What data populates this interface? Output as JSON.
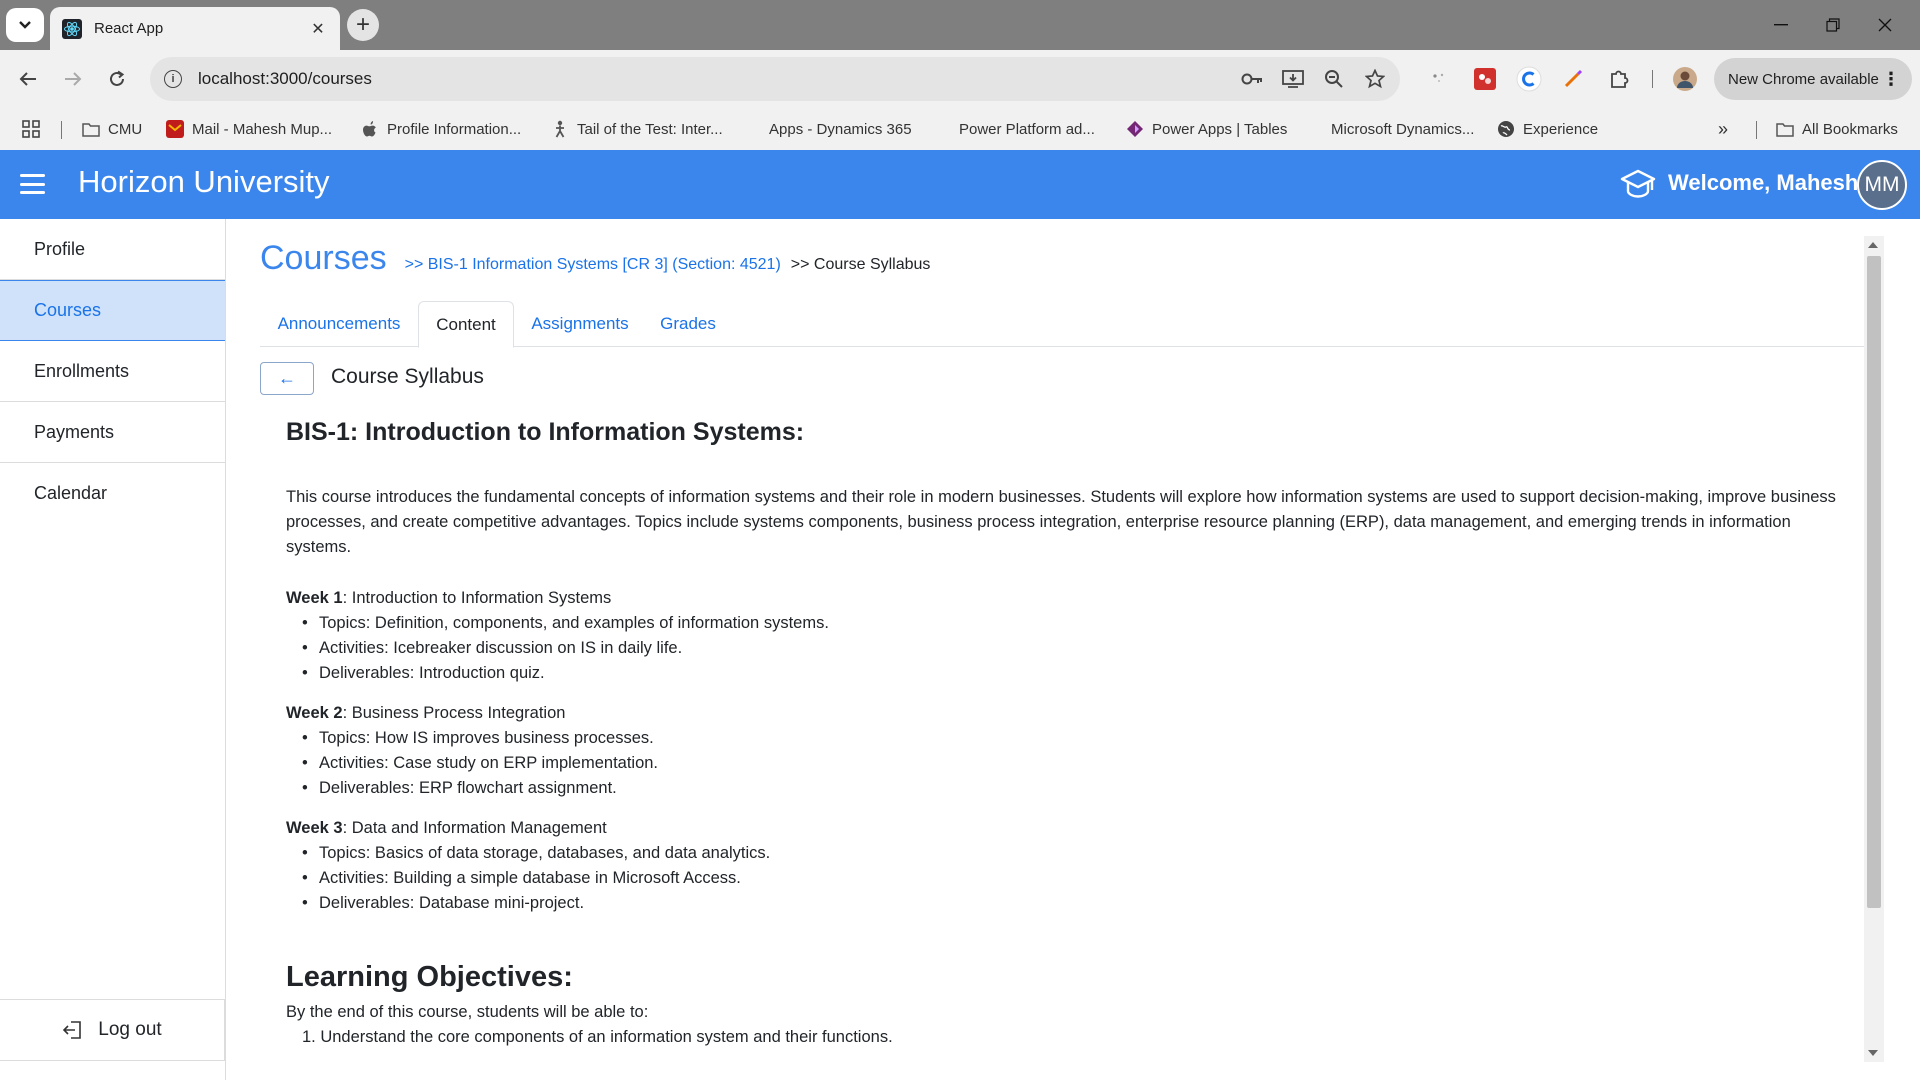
{
  "browser": {
    "tab_title": "React App",
    "url": "localhost:3000/courses",
    "update_label": "New Chrome available",
    "bookmarks": [
      {
        "label": "CMU",
        "icon": "folder-icon"
      },
      {
        "label": "Mail - Mahesh Mup...",
        "icon": "mail-icon"
      },
      {
        "label": "Profile Information...",
        "icon": "apple-icon"
      },
      {
        "label": "Tail of the Test: Inter...",
        "icon": "figure-icon"
      },
      {
        "label": "Apps - Dynamics 365",
        "icon": "microsoft-icon"
      },
      {
        "label": "Power Platform ad...",
        "icon": "microsoft-icon"
      },
      {
        "label": "Power Apps | Tables",
        "icon": "power-apps-icon"
      },
      {
        "label": "Microsoft Dynamics...",
        "icon": "microsoft-icon"
      },
      {
        "label": "Experience",
        "icon": "globe-icon"
      }
    ],
    "all_bookmarks_label": "All Bookmarks"
  },
  "header": {
    "brand": "Horizon University",
    "welcome": "Welcome, Mahesh",
    "avatar_initials": "MM",
    "colors": {
      "primary": "#3b86ed"
    }
  },
  "sidebar": {
    "items": [
      {
        "label": "Profile",
        "active": false
      },
      {
        "label": "Courses",
        "active": true
      },
      {
        "label": "Enrollments",
        "active": false
      },
      {
        "label": "Payments",
        "active": false
      },
      {
        "label": "Calendar",
        "active": false
      }
    ],
    "logout_label": "Log out"
  },
  "page": {
    "title": "Courses",
    "breadcrumb_link": ">> BIS-1 Information Systems [CR 3] (Section: 4521)",
    "breadcrumb_current": ">> Course Syllabus",
    "tabs": [
      {
        "label": "Announcements",
        "active": false
      },
      {
        "label": "Content",
        "active": true
      },
      {
        "label": "Assignments",
        "active": false
      },
      {
        "label": "Grades",
        "active": false
      }
    ],
    "back_arrow": "←",
    "section_heading": "Course Syllabus"
  },
  "syllabus": {
    "heading": "BIS-1: Introduction to Information Systems:",
    "intro": "This course introduces the fundamental concepts of information systems and their role in modern businesses. Students will explore how information systems are used to support decision-making, improve business processes, and create competitive advantages. Topics include systems components, business process integration, enterprise resource planning (ERP), data management, and emerging trends in information systems.",
    "weeks": [
      {
        "label": "Week 1",
        "title": ": Introduction to Information Systems",
        "items": [
          "Topics: Definition, components, and examples of information systems.",
          "Activities: Icebreaker discussion on IS in daily life.",
          "Deliverables: Introduction quiz."
        ]
      },
      {
        "label": "Week 2",
        "title": ": Business Process Integration",
        "items": [
          "Topics: How IS improves business processes.",
          "Activities: Case study on ERP implementation.",
          "Deliverables: ERP flowchart assignment."
        ]
      },
      {
        "label": "Week 3",
        "title": ": Data and Information Management",
        "items": [
          "Topics: Basics of data storage, databases, and data analytics.",
          "Activities: Building a simple database in Microsoft Access.",
          "Deliverables: Database mini-project."
        ]
      }
    ],
    "objectives_heading": "Learning Objectives:",
    "objectives_intro": "By the end of this course, students will be able to:",
    "objectives": [
      "1. Understand the core components of an information system and their functions."
    ]
  }
}
